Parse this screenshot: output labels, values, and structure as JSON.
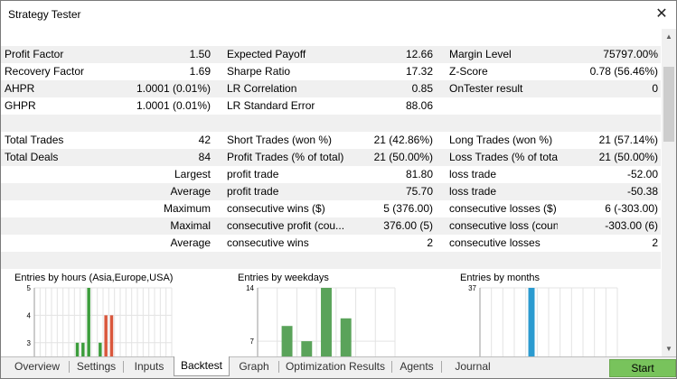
{
  "window": {
    "title": "Strategy Tester",
    "close_glyph": "✕"
  },
  "stats": [
    {
      "alt": true,
      "c1l": "Profit Factor",
      "c1r": "1.50",
      "c2l": "Expected Payoff",
      "c2r": "12.66",
      "c3l": "Margin Level",
      "c3r": "75797.00%"
    },
    {
      "alt": false,
      "c1l": "Recovery Factor",
      "c1r": "1.69",
      "c2l": "Sharpe Ratio",
      "c2r": "17.32",
      "c3l": "Z-Score",
      "c3r": "0.78 (56.46%)"
    },
    {
      "alt": true,
      "c1l": "AHPR",
      "c1r": "1.0001 (0.01%)",
      "c2l": "LR Correlation",
      "c2r": "0.85",
      "c3l": "OnTester result",
      "c3r": "0"
    },
    {
      "alt": false,
      "c1l": "GHPR",
      "c1r": "1.0001 (0.01%)",
      "c2l": "LR Standard Error",
      "c2r": "88.06",
      "c3l": "",
      "c3r": ""
    },
    {
      "alt": true,
      "c1l": "",
      "c1r": "",
      "c2l": "",
      "c2r": "",
      "c3l": "",
      "c3r": ""
    },
    {
      "alt": false,
      "c1l": "Total Trades",
      "c1r": "42",
      "c2l": "Short Trades (won %)",
      "c2r": "21 (42.86%)",
      "c3l": "Long Trades (won %)",
      "c3r": "21 (57.14%)"
    },
    {
      "alt": true,
      "c1l": "Total Deals",
      "c1r": "84",
      "c2l": "Profit Trades (% of total)",
      "c2r": "21 (50.00%)",
      "c3l": "Loss Trades (% of total)",
      "c3r": "21 (50.00%)"
    },
    {
      "alt": false,
      "c1l": "",
      "c1r": "Largest",
      "c2l": "profit trade",
      "c2r": "81.80",
      "c3l": "loss trade",
      "c3r": "-52.00"
    },
    {
      "alt": true,
      "c1l": "",
      "c1r": "Average",
      "c2l": "profit trade",
      "c2r": "75.70",
      "c3l": "loss trade",
      "c3r": "-50.38"
    },
    {
      "alt": false,
      "c1l": "",
      "c1r": "Maximum",
      "c2l": "consecutive wins ($)",
      "c2r": "5 (376.00)",
      "c3l": "consecutive losses ($)",
      "c3r": "6 (-303.00)"
    },
    {
      "alt": true,
      "c1l": "",
      "c1r": "Maximal",
      "c2l": "consecutive profit (cou...",
      "c2r": "376.00 (5)",
      "c3l": "consecutive loss (count)",
      "c3r": "-303.00 (6)"
    },
    {
      "alt": false,
      "c1l": "",
      "c1r": "Average",
      "c2l": "consecutive wins",
      "c2r": "2",
      "c3l": "consecutive losses",
      "c3r": "2"
    },
    {
      "alt": true,
      "c1l": "",
      "c1r": "",
      "c2l": "",
      "c2r": "",
      "c3l": "",
      "c3r": ""
    }
  ],
  "chart_data": [
    {
      "type": "bar",
      "title": "Entries by hours (Asia,Europe,USA)",
      "y_ticks": [
        "5",
        "4",
        "3"
      ],
      "ylim": [
        2.5,
        5
      ],
      "bars": [
        {
          "slot": 7,
          "value": 3,
          "color": "#3c9d3c"
        },
        {
          "slot": 8,
          "value": 3,
          "color": "#3c9d3c"
        },
        {
          "slot": 9,
          "value": 5,
          "color": "#3c9d3c"
        },
        {
          "slot": 11,
          "value": 3,
          "color": "#3c9d3c"
        },
        {
          "slot": 12,
          "value": 4,
          "color": "#d9573c"
        },
        {
          "slot": 13,
          "value": 4,
          "color": "#d9573c"
        }
      ],
      "slots": 24
    },
    {
      "type": "bar",
      "title": "Entries by weekdays",
      "y_ticks": [
        "14",
        "7"
      ],
      "ylim": [
        5,
        14
      ],
      "bars": [
        {
          "slot": 1,
          "value": 9,
          "color": "#5aa35a"
        },
        {
          "slot": 2,
          "value": 7,
          "color": "#5aa35a"
        },
        {
          "slot": 3,
          "value": 14,
          "color": "#5aa35a"
        },
        {
          "slot": 4,
          "value": 10,
          "color": "#5aa35a"
        }
      ],
      "slots": 7
    },
    {
      "type": "bar",
      "title": "Entries by months",
      "y_ticks": [
        "37"
      ],
      "ylim": [
        20,
        37
      ],
      "bars": [
        {
          "slot": 4,
          "value": 37,
          "color": "#2b9bd0"
        }
      ],
      "slots": 12
    }
  ],
  "tabs": [
    {
      "label": "Overview",
      "active": false
    },
    {
      "label": "Settings",
      "active": false
    },
    {
      "label": "Inputs",
      "active": false
    },
    {
      "label": "Backtest",
      "active": true
    },
    {
      "label": "Graph",
      "active": false
    },
    {
      "label": "Optimization Results",
      "active": false
    },
    {
      "label": "Agents",
      "active": false
    },
    {
      "label": "Journal",
      "active": false
    }
  ],
  "start_button": {
    "label": "Start"
  },
  "colors": {
    "start_green": "#78c35c",
    "row_alt": "#f0f0f0"
  }
}
